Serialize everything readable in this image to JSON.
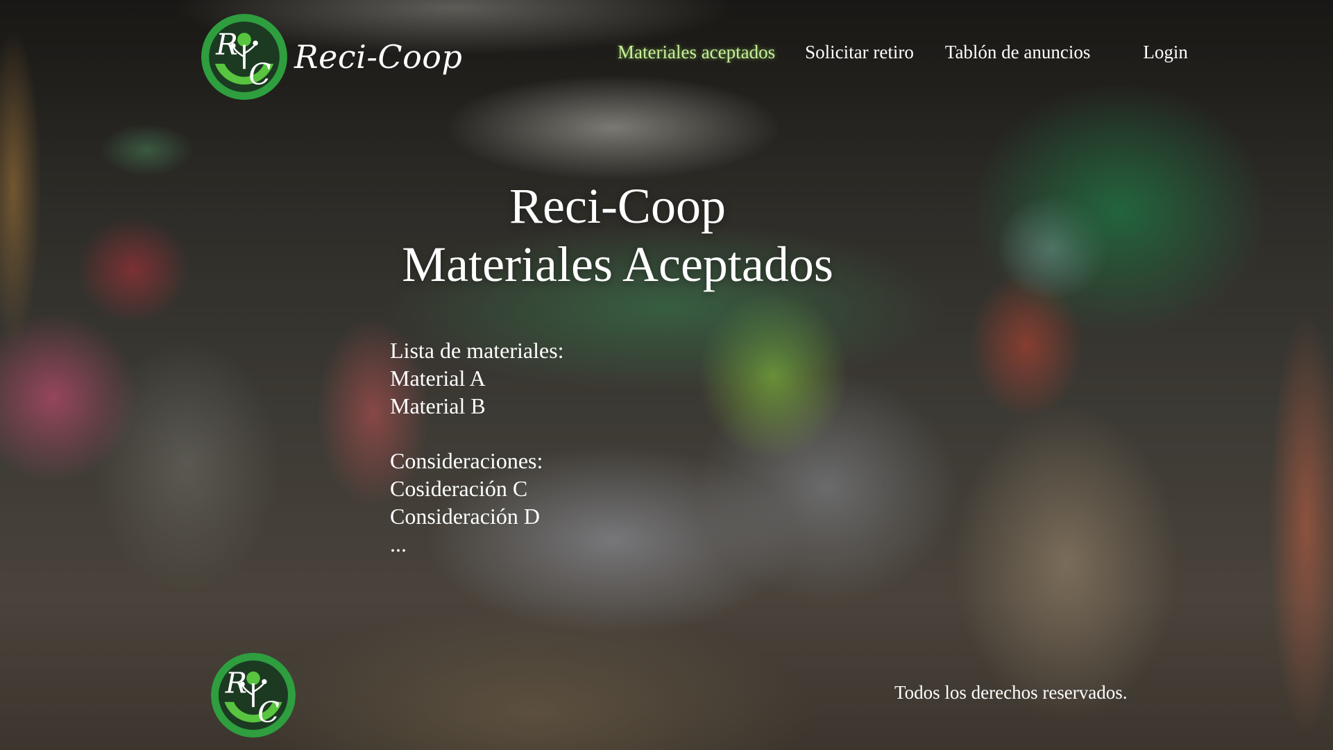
{
  "brand": {
    "name": "Reci-Coop",
    "logo_monogram_top": "R",
    "logo_monogram_bottom": "C",
    "logo_icon": "recycle-tree-icon"
  },
  "nav": {
    "items": [
      {
        "label": "Materiales aceptados",
        "active": true
      },
      {
        "label": "Solicitar retiro",
        "active": false
      },
      {
        "label": "Tablón de anuncios",
        "active": false
      }
    ],
    "login_label": "Login"
  },
  "hero": {
    "line1": "Reci-Coop",
    "line2": "Materiales Aceptados"
  },
  "materials": {
    "heading": "Lista de materiales:",
    "items": [
      "Material A",
      "Material B"
    ]
  },
  "considerations": {
    "heading": "Consideraciones:",
    "items": [
      "Cosideración C",
      "Consideración D"
    ],
    "more": "..."
  },
  "footer": {
    "rights": "Todos los derechos reservados."
  },
  "colors": {
    "nav_active": "#c9ef9c",
    "logo_green": "#2e9e3f",
    "logo_green_light": "#58c43f",
    "logo_dark": "#1c3a22"
  }
}
